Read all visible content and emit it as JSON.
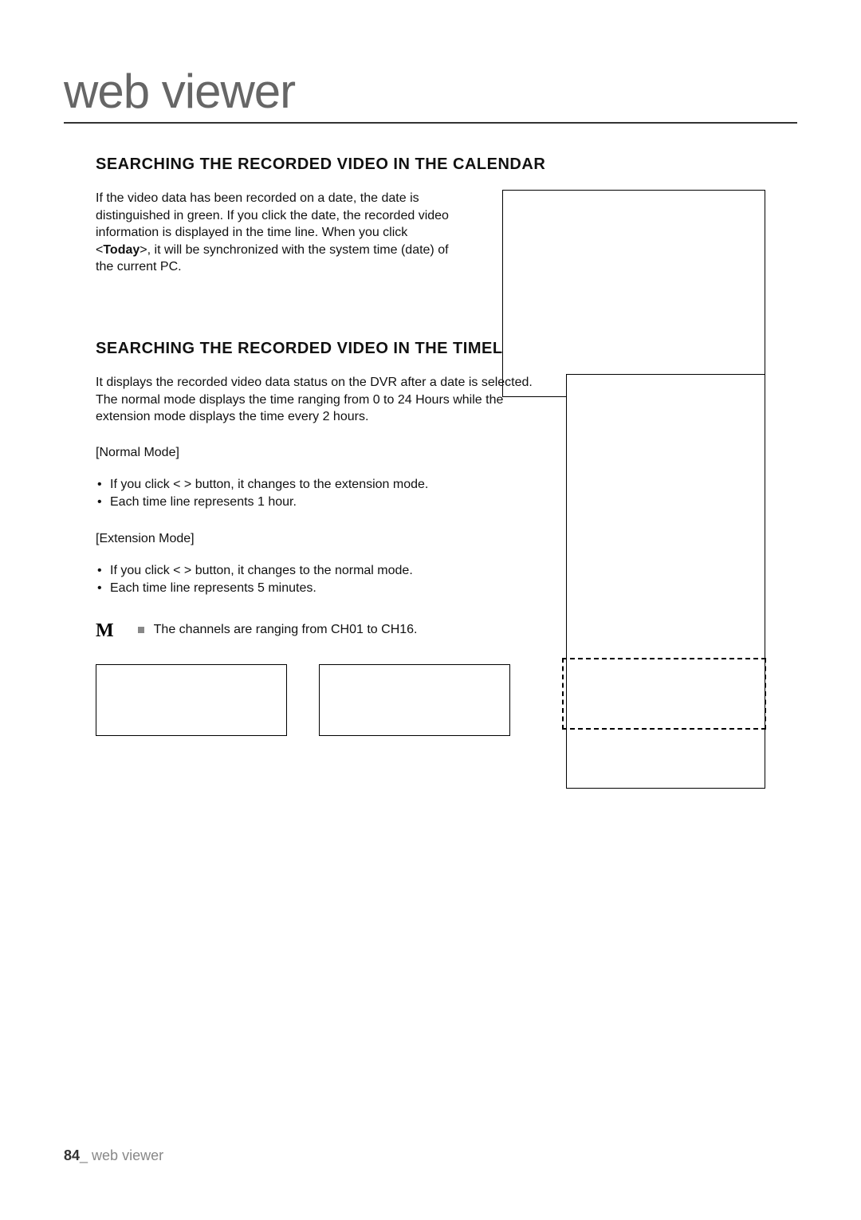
{
  "page_title": "web viewer",
  "section1": {
    "heading": "SEARCHING THE RECORDED VIDEO IN THE CALENDAR",
    "text_before": "If the video data has been recorded on a date, the date is distinguished in green. If you click the date, the recorded video information is displayed in the time line. When you click <",
    "bold_tag": "Today",
    "text_after": ">, it will be synchronized with the system time (date) of the current PC."
  },
  "section2": {
    "heading": "SEARCHING THE RECORDED VIDEO IN THE TIMELINE",
    "intro": "It displays the recorded video data status on the DVR after a date is selected. The normal mode displays the time ranging from 0 to 24 Hours while the extension mode displays the time every 2 hours.",
    "normal_label": "[Normal Mode]",
    "normal_bullets": [
      "If you click <   > button, it changes to the extension mode.",
      "Each time line represents 1 hour."
    ],
    "extension_label": "[Extension Mode]",
    "extension_bullets": [
      "If you click <   > button, it changes to the normal mode.",
      "Each time line represents 5 minutes."
    ],
    "note_symbol": "M",
    "note_text": "The channels are ranging from CH01 to CH16."
  },
  "footer": {
    "page_num": "84",
    "separator": "_",
    "label": " web viewer"
  }
}
